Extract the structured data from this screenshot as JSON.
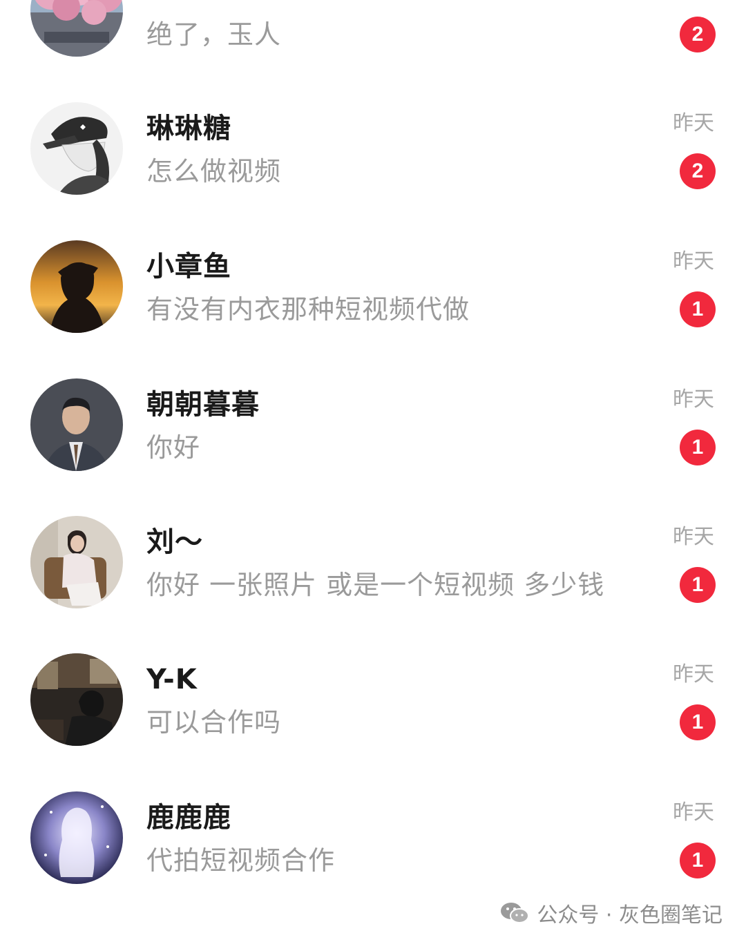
{
  "messages": [
    {
      "name": "",
      "preview": "绝了，玉人",
      "time": "",
      "unread": "2",
      "avatar": "cherry-blossom-photo"
    },
    {
      "name": "琳琳糖",
      "preview": "怎么做视频",
      "time": "昨天",
      "unread": "2",
      "avatar": "sketch-girl-cap"
    },
    {
      "name": "小章鱼",
      "preview": "有没有内衣那种短视频代做",
      "time": "昨天",
      "unread": "1",
      "avatar": "sunset-silhouette"
    },
    {
      "name": "朝朝暮暮",
      "preview": "你好",
      "time": "昨天",
      "unread": "1",
      "avatar": "man-in-suit"
    },
    {
      "name": "刘～",
      "preview": "你好  一张照片 或是一个短视频 多少钱",
      "time": "昨天",
      "unread": "1",
      "avatar": "woman-sitting-chair"
    },
    {
      "name": "Y-K",
      "preview": "可以合作吗",
      "time": "昨天",
      "unread": "1",
      "avatar": "dark-indoor-person"
    },
    {
      "name": "鹿鹿鹿",
      "preview": "代拍短视频合作",
      "time": "昨天",
      "unread": "1",
      "avatar": "glowing-anime-girl"
    }
  ],
  "watermark": {
    "icon": "wechat-icon",
    "text": "公众号 · 灰色圈笔记"
  },
  "colors": {
    "badge": "#f1293d",
    "name": "#1a1a1a",
    "preview": "#9a9a9a",
    "time": "#a6a6a6"
  }
}
